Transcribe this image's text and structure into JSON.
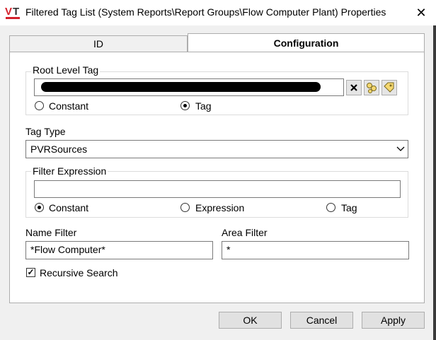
{
  "window": {
    "title": "Filtered Tag List (System Reports\\Report Groups\\Flow Computer Plant) Properties",
    "close_glyph": "✕"
  },
  "tabs": [
    {
      "label": "ID"
    },
    {
      "label": "Configuration"
    }
  ],
  "root_level_tag": {
    "group_label": "Root Level Tag",
    "radio_constant": "Constant",
    "radio_tag": "Tag",
    "selected": "Tag",
    "clear_icon": "clear-x-icon",
    "browse_icon": "tag-browser-icon",
    "properties_icon": "tag-properties-icon"
  },
  "tag_type": {
    "label": "Tag Type",
    "value": "PVRSources"
  },
  "filter_expression": {
    "group_label": "Filter Expression",
    "value": "",
    "radio_constant": "Constant",
    "radio_expression": "Expression",
    "radio_tag": "Tag",
    "selected": "Constant"
  },
  "name_filter": {
    "label": "Name Filter",
    "value": "*Flow Computer*"
  },
  "area_filter": {
    "label": "Area Filter",
    "value": "*"
  },
  "recursive_search": {
    "label": "Recursive Search",
    "checked": true
  },
  "buttons": {
    "ok": "OK",
    "cancel": "Cancel",
    "apply": "Apply"
  },
  "colors": {
    "logo_red": "#d4202a",
    "logo_dark": "#333333"
  }
}
